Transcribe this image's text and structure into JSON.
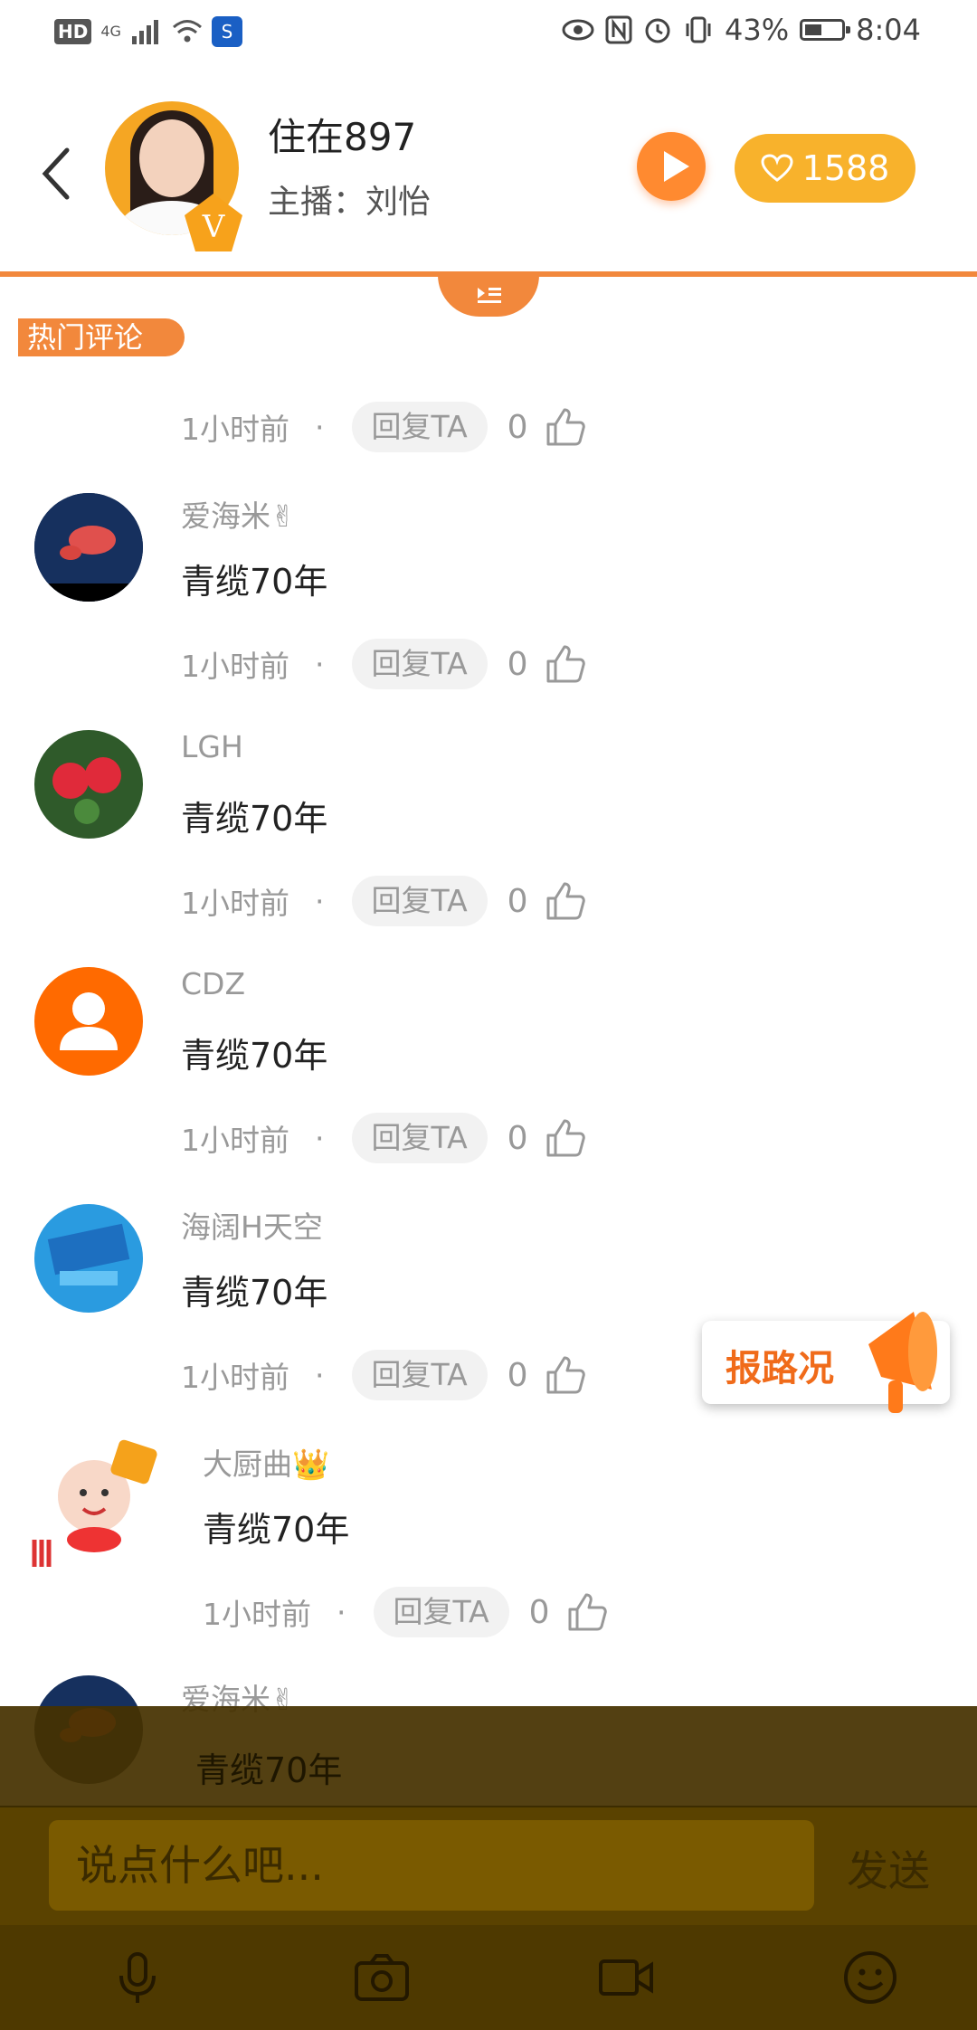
{
  "status_bar": {
    "hd": "HD",
    "network": "4G",
    "battery": "43%",
    "time": "8:04"
  },
  "header": {
    "title": "住在897",
    "host": "主播：刘怡",
    "like_count": "1588",
    "vip_badge": "V"
  },
  "section": {
    "hot_comments_label": "热门评论"
  },
  "comments": [
    {
      "name": "",
      "text": "",
      "time": "1小时前",
      "reply": "回复TA",
      "likes": "0"
    },
    {
      "name": "爱海米✌",
      "text": "青缆70年",
      "time": "1小时前",
      "reply": "回复TA",
      "likes": "0"
    },
    {
      "name": "LGH",
      "text": "青缆70年",
      "time": "1小时前",
      "reply": "回复TA",
      "likes": "0"
    },
    {
      "name": "CDZ",
      "text": "青缆70年",
      "time": "1小时前",
      "reply": "回复TA",
      "likes": "0"
    },
    {
      "name": "海阔H天空",
      "text": "青缆70年",
      "time": "1小时前",
      "reply": "回复TA",
      "likes": "0"
    },
    {
      "name": "大厨曲👑",
      "text": "青缆70年",
      "time": "1小时前",
      "reply": "回复TA",
      "likes": "0"
    },
    {
      "name": "爱海米✌",
      "text": "青缆70年"
    }
  ],
  "report_button": {
    "label": "报路况"
  },
  "composer": {
    "placeholder": "说点什么吧...",
    "send_label": "发送"
  },
  "toolbar": {
    "icons": [
      "microphone-icon",
      "camera-icon",
      "video-icon",
      "emoji-icon"
    ]
  },
  "colors": {
    "accent": "#f2883c",
    "like_pill": "#f8b22c",
    "overlay": "#4e3900"
  }
}
